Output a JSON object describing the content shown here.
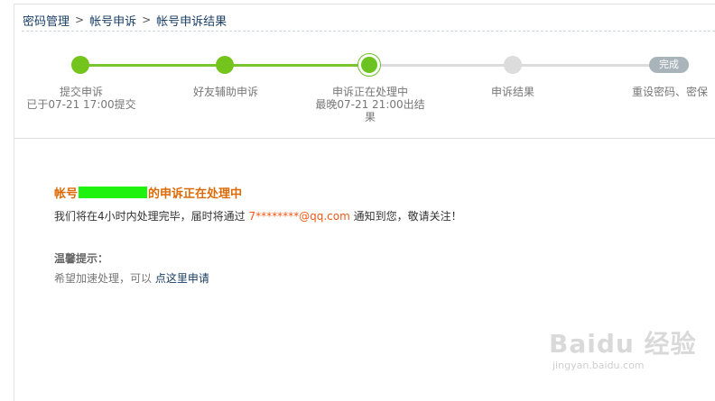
{
  "breadcrumb": {
    "items": [
      "密码管理",
      "帐号申诉",
      "帐号申诉结果"
    ],
    "separator": ">"
  },
  "progress": {
    "steps": [
      {
        "label": "提交申诉",
        "sub": "已于07-21  17:00提交",
        "state": "done"
      },
      {
        "label": "好友辅助申诉",
        "sub": "",
        "state": "done"
      },
      {
        "label": "申诉正在处理中",
        "sub": "最晚07-21  21:00出结",
        "sub2": "果",
        "state": "current"
      },
      {
        "label": "申诉结果",
        "sub": "",
        "state": "todo"
      },
      {
        "label": "重设密码、密保",
        "sub": "",
        "state": "todo"
      }
    ],
    "complete_label": "完成"
  },
  "status": {
    "prefix": "帐号",
    "suffix": "的申诉正在处理中"
  },
  "notify": {
    "text_before": "我们将在4小时内处理完毕，届时将通过 ",
    "email": "7********@qq.com",
    "text_after": " 通知到您，敬请关注！"
  },
  "tips": {
    "title": "温馨提示：",
    "text": "希望加速处理，可以 ",
    "link": "点这里申请"
  },
  "watermark": {
    "brand": "Baidu 经验",
    "url": "jingyan.baidu.com"
  },
  "colors": {
    "done": "#75c41e",
    "todo": "#dcdcdc",
    "accent_title": "#dd6a06",
    "email": "#ee5c1b",
    "mask": "#1ff20e"
  }
}
